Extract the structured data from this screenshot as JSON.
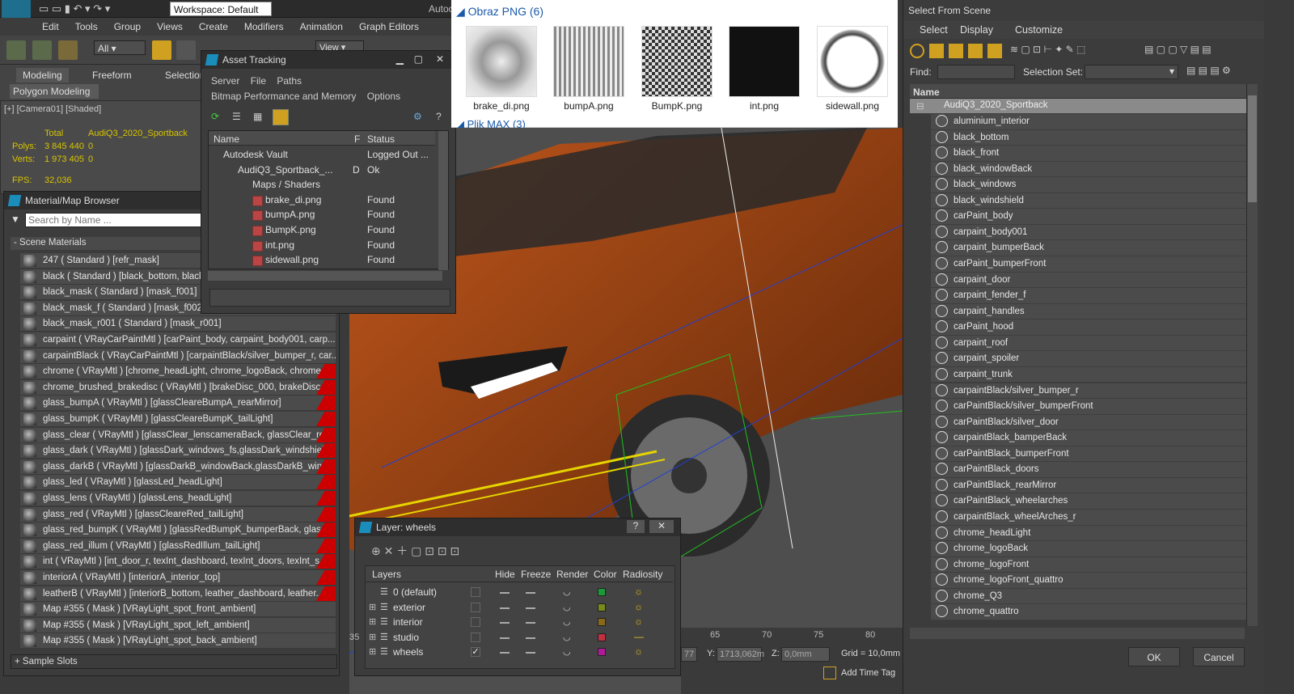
{
  "app": {
    "workspace_label": "Workspace: Default",
    "title_fragment": "Autoc"
  },
  "menu": [
    "Edit",
    "Tools",
    "Group",
    "Views",
    "Create",
    "Modifiers",
    "Animation",
    "Graph Editors"
  ],
  "toolbar": {
    "filter_value": "All",
    "view_value": "View"
  },
  "ribbon": {
    "tabs": [
      "Modeling",
      "Freeform",
      "Selection"
    ],
    "sub_label": "Polygon Modeling"
  },
  "viewport_label": "[+] [Camera01] [Shaded]",
  "stats": {
    "total_label": "Total",
    "object_name": "AudiQ3_2020_Sportback",
    "polys_label": "Polys:",
    "polys_value": "3 845 440",
    "polys_sel": "0",
    "verts_label": "Verts:",
    "verts_value": "1 973 405",
    "verts_sel": "0",
    "fps_label": "FPS:",
    "fps_value": "32,036"
  },
  "material_browser": {
    "title": "Material/Map Browser",
    "search_placeholder": "Search by Name ...",
    "section_scene": "- Scene Materials",
    "section_samples": "+ Sample Slots",
    "items": [
      "247 ( Standard ) [refr_mask]",
      "black ( Standard ) [black_bottom, black",
      "black_mask ( Standard ) [mask_f001]",
      "black_mask_f ( Standard ) [mask_f002]",
      "black_mask_r001 ( Standard ) [mask_r001]",
      "carpaint ( VRayCarPaintMtl ) [carPaint_body, carpaint_body001, carp...",
      "carpaintBlack ( VRayCarPaintMtl ) [carpaintBlack/silver_bumper_r, car...",
      "chrome ( VRayMtl ) [chrome_headLight, chrome_logoBack, chrome_...",
      "chrome_brushed_brakedisc ( VRayMtl ) [brakeDisc_000, brakeDisc_0...",
      "glass_bumpA ( VRayMtl ) [glassCleareBumpA_rearMirror]",
      "glass_bumpK ( VRayMtl ) [glassCleareBumpK_tailLight]",
      "glass_clear ( VRayMtl ) [glassClear_lenscameraBack, glassClear_rea...",
      "glass_dark ( VRayMtl ) [glassDark_windows_fs,glassDark_windshield]",
      "glass_darkB ( VRayMtl ) [glassDarkB_windowBack,glassDarkB_windo...",
      "glass_led ( VRayMtl ) [glassLed_headLight]",
      "glass_lens ( VRayMtl ) [glassLens_headLight]",
      "glass_red ( VRayMtl ) [glassCleareRed_tailLight]",
      "glass_red_bumpK ( VRayMtl ) [glassRedBumpK_bumperBack, glassRe...",
      "glass_red_illum ( VRayMtl ) [glassRedIllum_tailLight]",
      "int ( VRayMtl ) [int_door_r, texInt_dashboard, texInt_doors, texInt_s...",
      "interiorA ( VRayMtl ) [interiorA_interior_top]",
      "leatherB ( VRayMtl ) [interiorB_bottom, leather_dashboard, leather...",
      "Map #355 ( Mask ) [VRayLight_spot_front_ambient]",
      "Map #355 ( Mask ) [VRayLight_spot_left_ambient]",
      "Map #355 ( Mask ) [VRayLight_spot_back_ambient]"
    ]
  },
  "asset_tracking": {
    "title": "Asset Tracking",
    "menu": [
      "Server",
      "File",
      "Paths"
    ],
    "menu2": [
      "Bitmap Performance and Memory",
      "Options"
    ],
    "columns": [
      "Name",
      "F",
      "Status"
    ],
    "rows": [
      {
        "name": "Autodesk Vault",
        "f": "",
        "status": "Logged Out ..."
      },
      {
        "name": "AudiQ3_Sportback_...",
        "f": "D",
        "status": "Ok"
      },
      {
        "name": "Maps / Shaders",
        "f": "",
        "status": ""
      },
      {
        "name": "brake_di.png",
        "f": "",
        "status": "Found"
      },
      {
        "name": "bumpA.png",
        "f": "",
        "status": "Found"
      },
      {
        "name": "BumpK.png",
        "f": "",
        "status": "Found"
      },
      {
        "name": "int.png",
        "f": "",
        "status": "Found"
      },
      {
        "name": "sidewall.png",
        "f": "",
        "status": "Found"
      }
    ]
  },
  "thumbnails": {
    "group_title": "Obraz PNG (6)",
    "group2_title": "Plik MAX (3)",
    "items": [
      "brake_di.png",
      "bumpA.png",
      "BumpK.png",
      "int.png",
      "sidewall.png"
    ]
  },
  "select_scene": {
    "title": "Select From Scene",
    "menu": [
      "Select",
      "Display",
      "Customize"
    ],
    "find_label": "Find:",
    "selection_set_label": "Selection Set:",
    "column_name": "Name",
    "root": "AudiQ3_2020_Sportback",
    "items": [
      "aluminium_interior",
      "black_bottom",
      "black_front",
      "black_windowBack",
      "black_windows",
      "black_windshield",
      "carPaint_body",
      "carpaint_body001",
      "carpaint_bumperBack",
      "carPaint_bumperFront",
      "carpaint_door",
      "carpaint_fender_f",
      "carpaint_handles",
      "carPaint_hood",
      "carpaint_roof",
      "carpaint_spoiler",
      "carpaint_trunk",
      "carpaintBlack/silver_bumper_r",
      "carPaintBlack/silver_bumperFront",
      "carPaintBlack/silver_door",
      "carpaintBlack_bamperBack",
      "carPaintBlack_bumperFront",
      "carPaintBlack_doors",
      "carPaintBlack_rearMirror",
      "carPaintBlack_wheelarches",
      "carpaintBlack_wheelArches_r",
      "chrome_headLight",
      "chrome_logoBack",
      "chrome_logoFront",
      "chrome_logoFront_quattro",
      "chrome_Q3",
      "chrome_quattro"
    ],
    "ok_label": "OK",
    "cancel_label": "Cancel"
  },
  "layer_dialog": {
    "title": "Layer: wheels",
    "help": "?",
    "columns": [
      "Layers",
      "Hide",
      "Freeze",
      "Render",
      "Color",
      "Radiosity"
    ],
    "rows": [
      {
        "name": "0 (default)",
        "color": "#1a9b3a",
        "radiosity_icon": "lamp-icon",
        "current": false
      },
      {
        "name": "exterior",
        "color": "#7a8a1a",
        "radiosity_icon": "lamp-icon",
        "current": false
      },
      {
        "name": "interior",
        "color": "#8a6a1a",
        "radiosity_icon": "lamp-icon",
        "current": false
      },
      {
        "name": "studio",
        "color": "#c03040",
        "radiosity_icon": "dash-icon",
        "current": false
      },
      {
        "name": "wheels",
        "color": "#b01a9a",
        "radiosity_icon": "lamp-icon",
        "current": true
      }
    ]
  },
  "statusbar": {
    "x_value": "77",
    "y_label": "Y:",
    "y_value": "1713,062m",
    "z_label": "Z:",
    "z_value": "0,0mm",
    "grid_label": "Grid = 10,0mm",
    "add_time_tag": "Add Time Tag",
    "ruler": [
      "65",
      "70",
      "75",
      "80"
    ],
    "ruler_left": "35"
  },
  "colors": {
    "accent": "#1a8dbb",
    "max_bg": "#3c3c3c",
    "car_orange": "#b0501a",
    "stat_yellow": "#d8c400"
  }
}
